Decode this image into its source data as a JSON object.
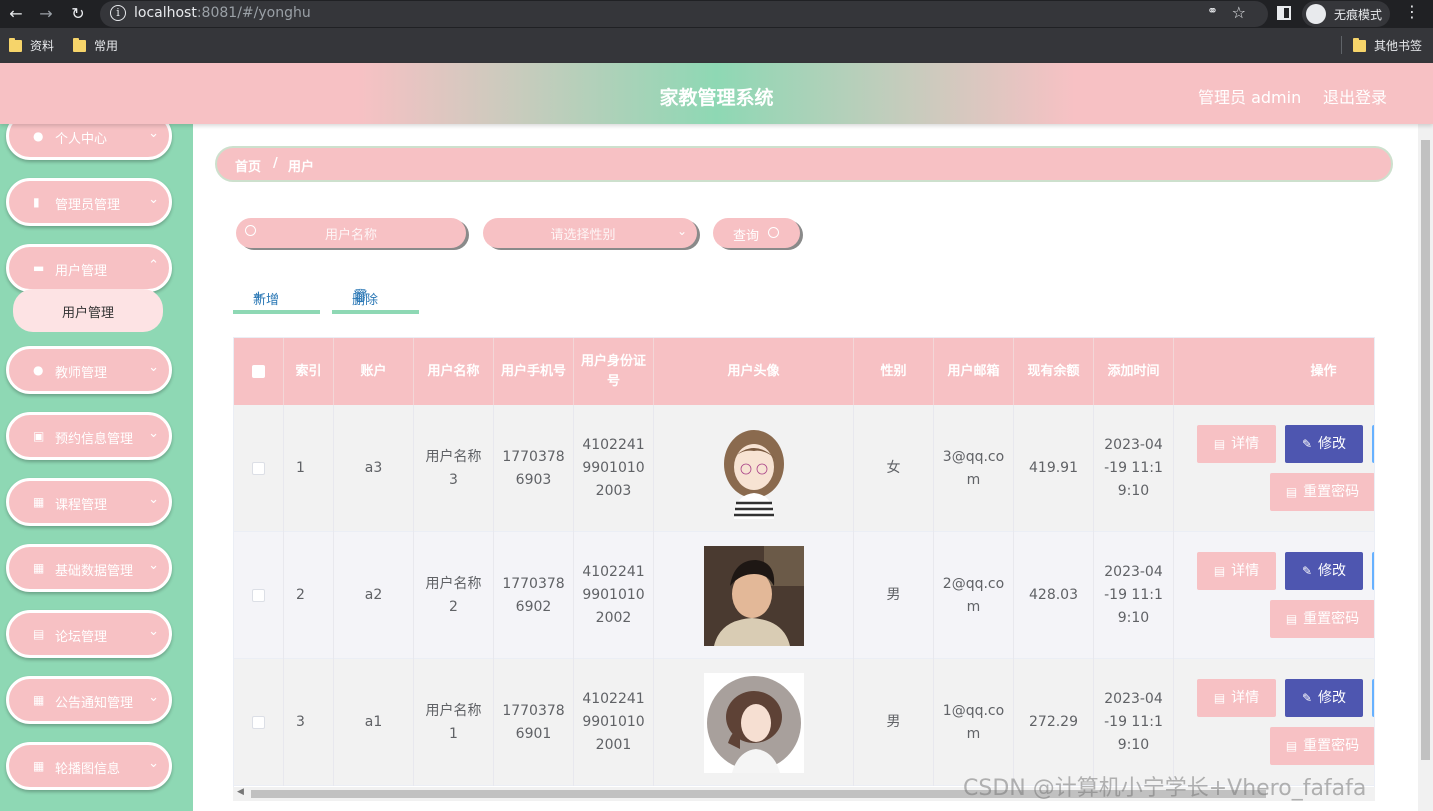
{
  "browser": {
    "url_host": "localhost",
    "url_rest": ":8081/#/yonghu",
    "incognito_label": "无痕模式",
    "bookmarks": [
      "资料",
      "常用"
    ],
    "other_bookmarks": "其他书签"
  },
  "header": {
    "title": "家教管理系统",
    "admin_label": "管理员 admin",
    "logout_label": "退出登录"
  },
  "sidebar": {
    "items": [
      {
        "label": "个人中心",
        "icon": "user-icon"
      },
      {
        "label": "管理员管理",
        "icon": "clipboard-icon"
      },
      {
        "label": "用户管理",
        "icon": "ticket-icon"
      },
      {
        "label": "教师管理",
        "icon": "user-icon"
      },
      {
        "label": "预约信息管理",
        "icon": "briefcase-icon"
      },
      {
        "label": "课程管理",
        "icon": "grid-icon"
      },
      {
        "label": "基础数据管理",
        "icon": "grid-icon"
      },
      {
        "label": "论坛管理",
        "icon": "chart-icon"
      },
      {
        "label": "公告通知管理",
        "icon": "grid-icon"
      },
      {
        "label": "轮播图信息",
        "icon": "grid-icon"
      }
    ],
    "active_submenu": "用户管理"
  },
  "breadcrumb": {
    "home": "首页",
    "separator": "/",
    "current": "用户"
  },
  "search": {
    "name_placeholder": "用户名称",
    "gender_placeholder": "请选择性别",
    "query_label": "查询"
  },
  "actions": {
    "add_label": "新增",
    "delete_label": "删除"
  },
  "table": {
    "columns": [
      "索引",
      "账户",
      "用户名称",
      "用户手机号",
      "用户身份证号",
      "用户头像",
      "性别",
      "用户邮箱",
      "现有余额",
      "添加时间",
      "操作"
    ],
    "rows": [
      {
        "index": "1",
        "account": "a3",
        "name": "用户名称3",
        "phone": "17703786903",
        "id_card": "410224199010102003",
        "avatar": "girl-illustration",
        "gender": "女",
        "email": "3@qq.com",
        "balance": "419.91",
        "time": "2023-04-19 11:19:10"
      },
      {
        "index": "2",
        "account": "a2",
        "name": "用户名称2",
        "phone": "17703786902",
        "id_card": "410224199010102002",
        "avatar": "boy-photo",
        "gender": "男",
        "email": "2@qq.com",
        "balance": "428.03",
        "time": "2023-04-19 11:19:10"
      },
      {
        "index": "3",
        "account": "a1",
        "name": "用户名称1",
        "phone": "17703786901",
        "id_card": "410224199010102001",
        "avatar": "girl-illustration-2",
        "gender": "男",
        "email": "1@qq.com",
        "balance": "272.29",
        "time": "2023-04-19 11:19:10"
      }
    ],
    "row_actions": {
      "detail": "详情",
      "edit": "修改",
      "reset": "重置密码"
    }
  },
  "watermark": "CSDN @计算机小宁学长+Vhero_fafafa",
  "colors": {
    "pink": "#f7c1c4",
    "green": "#8ed8b4",
    "edit_button": "#4e56b0",
    "link_blue": "#2a77b5"
  }
}
